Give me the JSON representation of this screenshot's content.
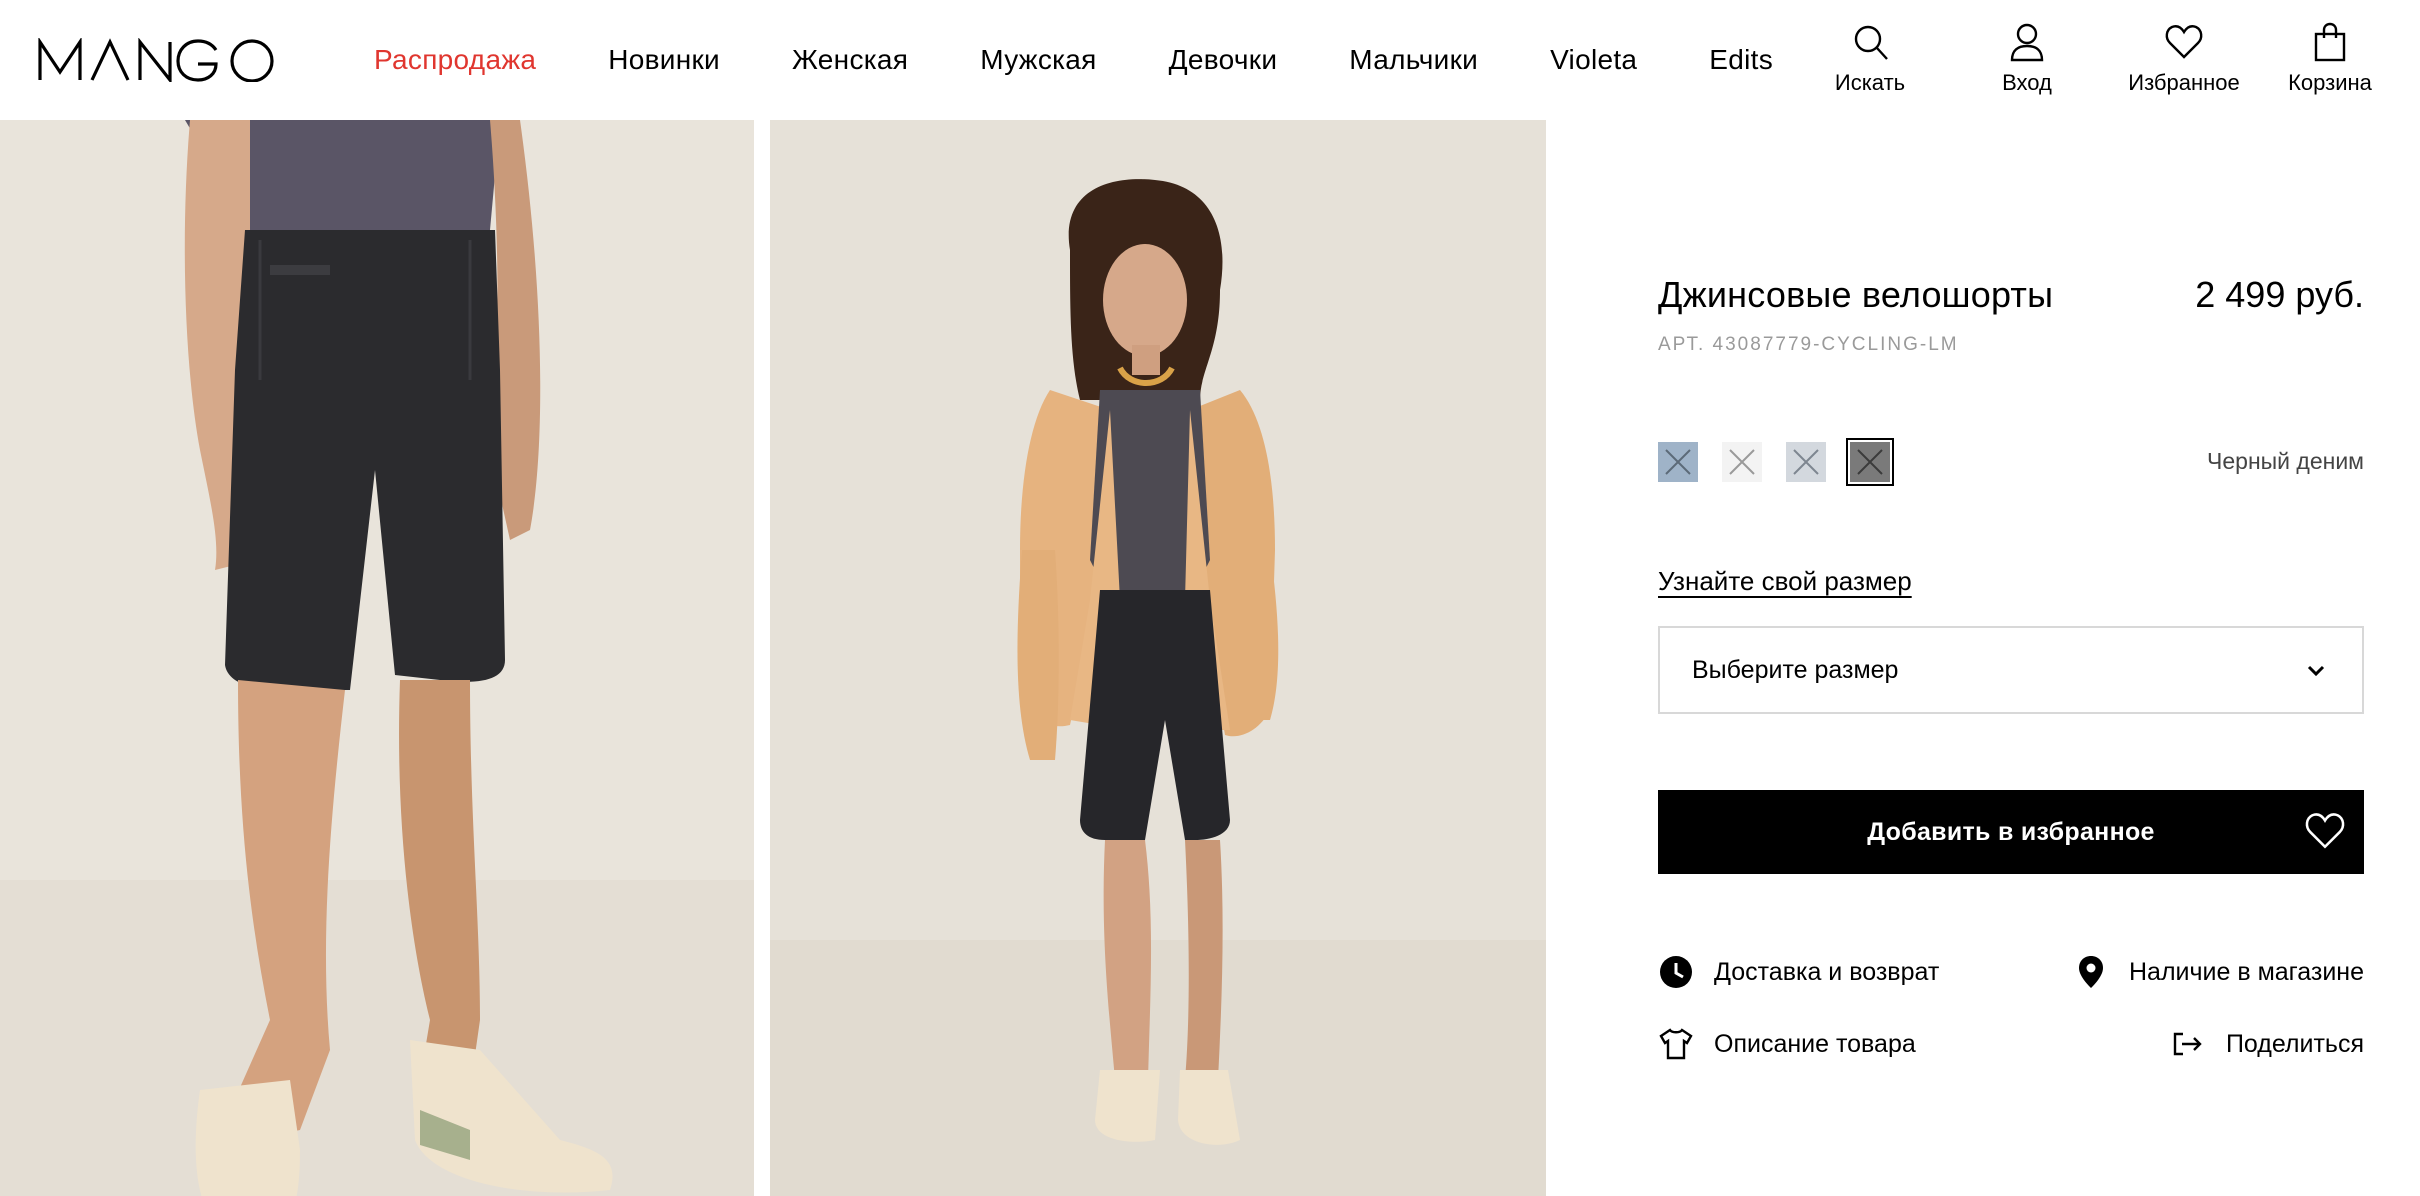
{
  "brand": {
    "logo_text": "MANGO"
  },
  "nav": {
    "items": [
      {
        "label": "Распродажа",
        "highlight": true
      },
      {
        "label": "Новинки"
      },
      {
        "label": "Женская"
      },
      {
        "label": "Мужская"
      },
      {
        "label": "Девочки"
      },
      {
        "label": "Мальчики"
      },
      {
        "label": "Violeta"
      },
      {
        "label": "Edits"
      }
    ],
    "sale_color": "#e0362f"
  },
  "tools": {
    "search": {
      "label": "Искать",
      "icon": "search-icon"
    },
    "login": {
      "label": "Вход",
      "icon": "user-icon"
    },
    "favorites": {
      "label": "Избранное",
      "icon": "heart-icon"
    },
    "cart": {
      "label": "Корзина",
      "icon": "bag-icon"
    }
  },
  "product": {
    "title": "Джинсовые велошорты",
    "price": "2 499 руб.",
    "sku": "АРТ. 43087779-CYCLING-LM",
    "colors": [
      {
        "name": "light-blue",
        "hex": "#9fb3c8"
      },
      {
        "name": "white",
        "hex": "#f3f3f3"
      },
      {
        "name": "light-grey",
        "hex": "#d3d8de"
      },
      {
        "name": "black-denim",
        "hex": "#7a7a7a",
        "selected": true
      }
    ],
    "selected_color_name": "Черный деним",
    "size_guide_label": "Узнайте свой размер",
    "size_placeholder": "Выберите размер",
    "add_to_favorites_label": "Добавить в избранное"
  },
  "links": {
    "delivery": "Доставка и возврат",
    "store": "Наличие в магазине",
    "description": "Описание товара",
    "share": "Поделиться"
  }
}
